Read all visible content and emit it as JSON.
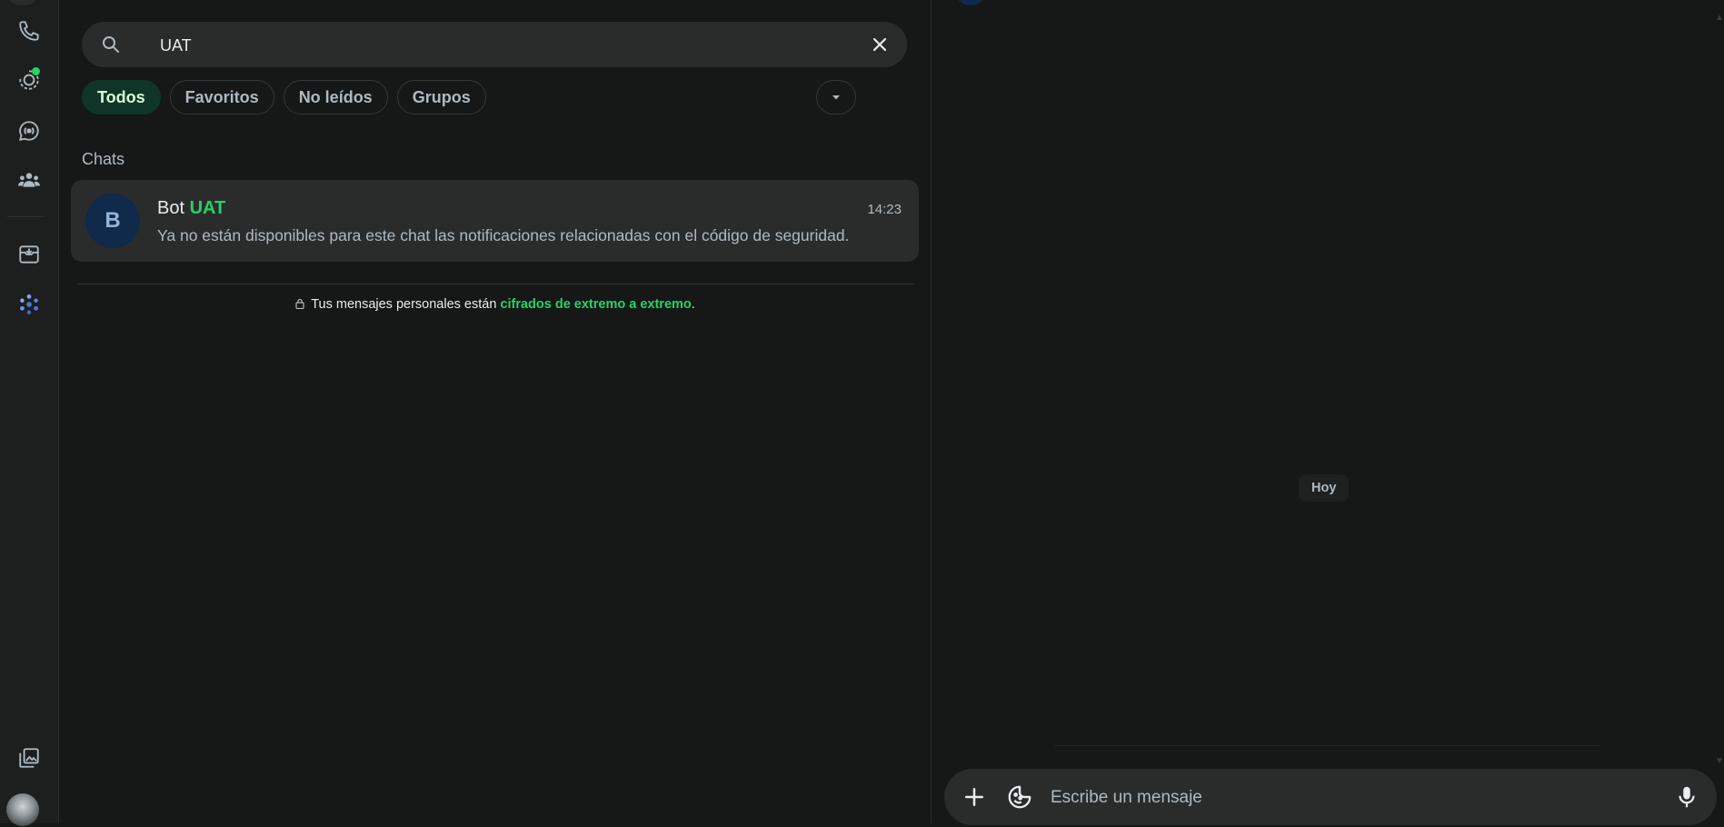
{
  "search": {
    "value": "UAT"
  },
  "filters": [
    {
      "label": "Todos",
      "active": true
    },
    {
      "label": "Favoritos",
      "active": false
    },
    {
      "label": "No leídos",
      "active": false
    },
    {
      "label": "Grupos",
      "active": false
    }
  ],
  "section_title": "Chats",
  "chats": [
    {
      "avatar_letter": "B",
      "name_prefix": "Bot ",
      "name_highlight": "UAT",
      "time": "14:23",
      "preview": "Ya no están disponibles para este chat las notificaciones relacionadas con el código de seguridad."
    }
  ],
  "encryption": {
    "prefix": "Tus mensajes personales están ",
    "link": "cifrados de extremo a extremo",
    "suffix": "."
  },
  "conversation": {
    "date_badge": "Hoy",
    "composer_placeholder": "Escribe un mensaje"
  },
  "colors": {
    "accent": "#25d366",
    "active_chip_bg": "#103529",
    "background": "#161717",
    "panel": "#2a2c2c"
  },
  "icons": {
    "rail": [
      "calls-icon",
      "status-icon",
      "channels-icon",
      "communities-icon",
      "archive-icon",
      "meta-ai-icon",
      "media-gallery-icon"
    ],
    "search": "search-icon",
    "clear": "close-icon",
    "filters_more": "chevron-down-icon",
    "composer": [
      "plus-icon",
      "sticker-icon",
      "microphone-icon"
    ]
  }
}
